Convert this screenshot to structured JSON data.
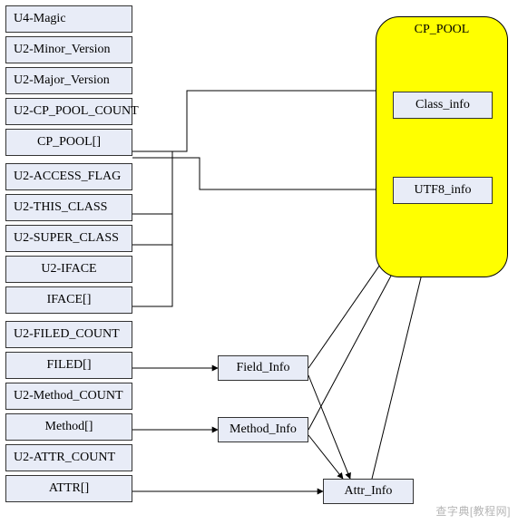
{
  "left_items": [
    "U4-Magic",
    "U2-Minor_Version",
    "U2-Major_Version",
    "U2-CP_POOL_COUNT",
    "CP_POOL[]",
    "U2-ACCESS_FLAG",
    "U2-THIS_CLASS",
    "U2-SUPER_CLASS",
    "U2-IFACE",
    "IFACE[]",
    "U2-FILED_COUNT",
    "FILED[]",
    "U2-Method_COUNT",
    "Method[]",
    "U2-ATTR_COUNT",
    "ATTR[]"
  ],
  "pool": {
    "title": "CP_POOL",
    "items": [
      "Class_info",
      "UTF8_info"
    ]
  },
  "mid_boxes": {
    "field": "Field_Info",
    "method": "Method_Info",
    "attr": "Attr_Info"
  },
  "watermark": "查字典[教程网]",
  "colors": {
    "box_fill": "#e8ecf7",
    "pool_fill": "#ffff00",
    "line": "#000000"
  }
}
